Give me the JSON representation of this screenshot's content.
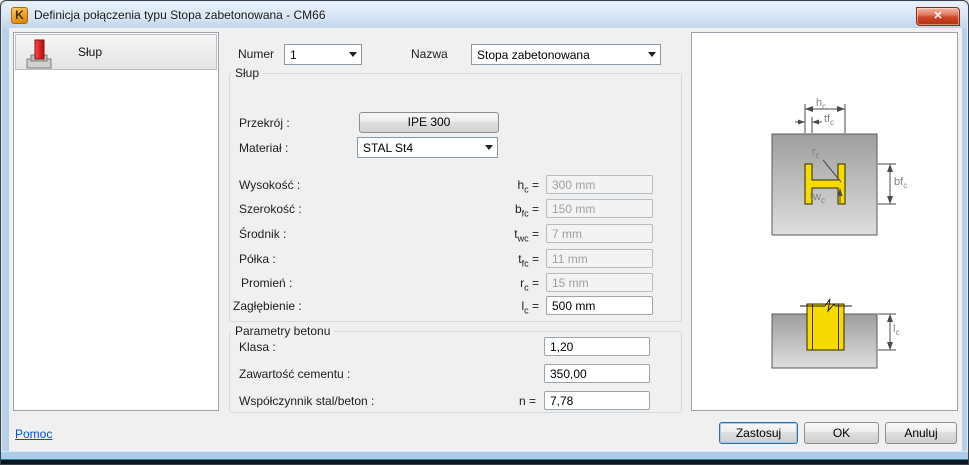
{
  "window": {
    "title": "Definicja połączenia typu Stopa zabetonowana - CM66"
  },
  "sidebar": {
    "items": [
      {
        "label": "Słup"
      }
    ]
  },
  "header": {
    "numer_label": "Numer",
    "numer_value": "1",
    "nazwa_label": "Nazwa",
    "nazwa_value": "Stopa zabetonowana"
  },
  "slup_group": {
    "title": "Słup",
    "przekroj_label": "Przekrój :",
    "przekroj_button": "IPE 300",
    "material_label": "Materiał :",
    "material_value": "STAL St4",
    "params": [
      {
        "label": "Wysokość :",
        "sym": "h",
        "sub": "c",
        "eq": "=",
        "value": "300 mm",
        "enabled": false
      },
      {
        "label": "Szerokość :",
        "sym": "b",
        "sub": "fc",
        "eq": "=",
        "value": "150 mm",
        "enabled": false
      },
      {
        "label": "Środnik :",
        "sym": "t",
        "sub": "wc",
        "eq": "=",
        "value": "7 mm",
        "enabled": false
      },
      {
        "label": "Półka :",
        "sym": "t",
        "sub": "fc",
        "eq": "=",
        "value": "11 mm",
        "enabled": false
      },
      {
        "label": "Promień :",
        "sym": "r",
        "sub": "c",
        "eq": "=",
        "value": "15 mm",
        "enabled": false
      },
      {
        "label": "Zagłębienie :",
        "sym": "l",
        "sub": "c",
        "eq": "=",
        "value": "500 mm",
        "enabled": true
      }
    ]
  },
  "concrete_group": {
    "title": "Parametry betonu",
    "rows": [
      {
        "label": "Klasa :",
        "sym": "",
        "eq": "",
        "value": "1,20"
      },
      {
        "label": "Zawartość cementu :",
        "sym": "",
        "eq": "",
        "value": "350,00"
      },
      {
        "label": "Współczynnik stal/beton :",
        "sym": "n",
        "eq": "=",
        "value": "7,78"
      }
    ]
  },
  "diagram": {
    "section": {
      "hc": "h",
      "hc_sub": "c",
      "tfc": "tf",
      "tfc_sub": "c",
      "rc": "r",
      "rc_sub": "c",
      "twc": "tw",
      "twc_sub": "c",
      "bfc": "bf",
      "bfc_sub": "c"
    },
    "embed": {
      "lc": "l",
      "lc_sub": "c"
    }
  },
  "footer": {
    "help": "Pomoc",
    "apply": "Zastosuj",
    "ok": "OK",
    "cancel": "Anuluj"
  },
  "colors": {
    "steel_yellow": "#f7da00",
    "column_red": "#e02020",
    "titlebar_blue": "#cfe0f2",
    "close_red": "#cc4527"
  }
}
